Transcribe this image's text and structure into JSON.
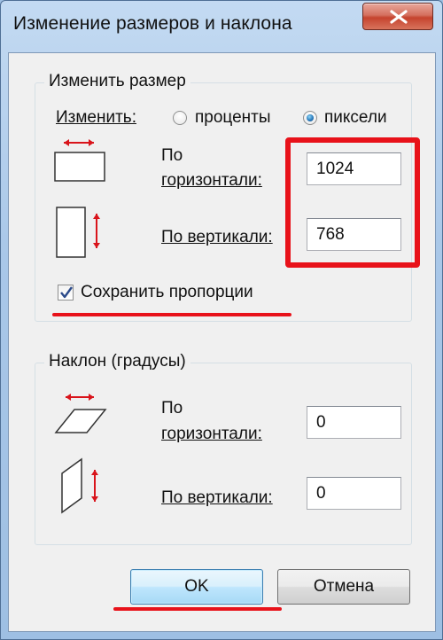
{
  "window": {
    "title": "Изменение размеров и наклона",
    "close_icon": "close-icon"
  },
  "resize": {
    "legend": "Изменить размер",
    "by_label": "Изменить:",
    "option_percent": "проценты",
    "option_pixels": "пиксели",
    "selected": "пиксели",
    "horizontal_label_line1": "По",
    "horizontal_label_line2": "горизонтали:",
    "horizontal_value": "1024",
    "vertical_label": "По вертикали:",
    "vertical_value": "768",
    "keep_ratio_label": "Сохранить пропорции",
    "keep_ratio_checked": true
  },
  "skew": {
    "legend": "Наклон (градусы)",
    "horizontal_label_line1": "По",
    "horizontal_label_line2": "горизонтали:",
    "horizontal_value": "0",
    "vertical_label": "По вертикали:",
    "vertical_value": "0"
  },
  "buttons": {
    "ok": "OK",
    "cancel": "Отмена"
  },
  "colors": {
    "annotation_red": "#e8121a",
    "arrow_red": "#d9141b"
  }
}
